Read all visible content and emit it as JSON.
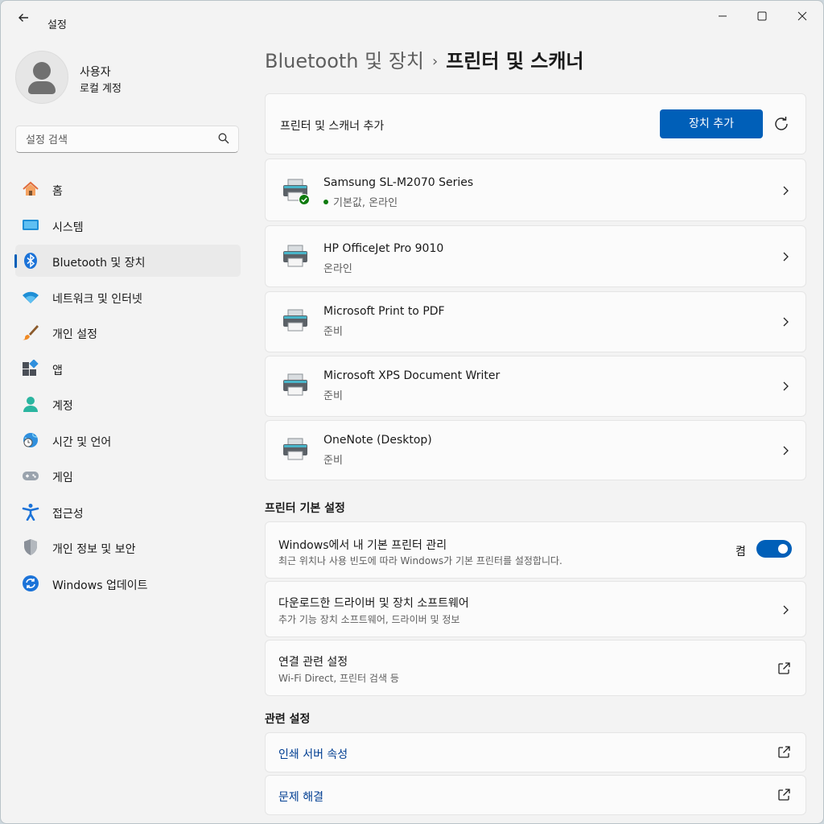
{
  "window": {
    "title": "설정",
    "back_icon": "arrow-left-icon",
    "controls": [
      "minimize-icon",
      "maximize-icon",
      "close-icon"
    ]
  },
  "profile": {
    "name": "사용자",
    "account": "로컬 계정"
  },
  "search": {
    "placeholder": "설정 검색"
  },
  "sidebar": {
    "items": [
      {
        "label": "홈",
        "icon": "home-icon"
      },
      {
        "label": "시스템",
        "icon": "system-icon"
      },
      {
        "label": "Bluetooth 및 장치",
        "icon": "bluetooth-icon",
        "selected": true
      },
      {
        "label": "네트워크 및 인터넷",
        "icon": "wifi-icon"
      },
      {
        "label": "개인 설정",
        "icon": "brush-icon"
      },
      {
        "label": "앱",
        "icon": "apps-icon"
      },
      {
        "label": "계정",
        "icon": "account-icon"
      },
      {
        "label": "시간 및 언어",
        "icon": "globe-clock-icon"
      },
      {
        "label": "게임",
        "icon": "gamepad-icon"
      },
      {
        "label": "접근성",
        "icon": "accessibility-icon"
      },
      {
        "label": "개인 정보 및 보안",
        "icon": "shield-icon"
      },
      {
        "label": "Windows 업데이트",
        "icon": "update-icon"
      }
    ]
  },
  "breadcrumb": {
    "parent": "Bluetooth 및 장치",
    "separator": "›",
    "current": "프린터 및 스캐너"
  },
  "add_card": {
    "label": "프린터 및 스캐너 추가",
    "button": "장치 추가",
    "refresh_icon": "refresh-icon"
  },
  "printers": [
    {
      "name": "Samsung SL-M2070 Series",
      "status": "기본값, 온라인",
      "default": true
    },
    {
      "name": "HP OfficeJet Pro 9010",
      "status": "온라인"
    },
    {
      "name": "Microsoft Print to PDF",
      "status": "준비"
    },
    {
      "name": "Microsoft XPS Document Writer",
      "status": "준비"
    },
    {
      "name": "OneNote (Desktop)",
      "status": "준비"
    }
  ],
  "printer_prefs": {
    "heading": "프린터 기본 설정",
    "manage_default": {
      "title": "Windows에서 내 기본 프린터 관리",
      "subtitle": "최근 위치나 사용 빈도에 따라 Windows가 기본 프린터를 설정합니다.",
      "toggle_label": "켬",
      "on": true
    },
    "drivers": {
      "title": "다운로드한 드라이버 및 장치 소프트웨어",
      "subtitle": "추가 기능 장치 소프트웨어, 드라이버 및 정보"
    },
    "connection": {
      "title": "연결 관련 설정",
      "subtitle": "Wi-Fi Direct, 프린터 검색 등"
    }
  },
  "related": {
    "heading": "관련 설정",
    "links": [
      "인쇄 서버 속성",
      "문제 해결"
    ]
  },
  "colors": {
    "accent": "#005fb8",
    "online_dot": "#0f7b0f",
    "background": "#f3f3f3",
    "card": "#fbfbfb"
  }
}
